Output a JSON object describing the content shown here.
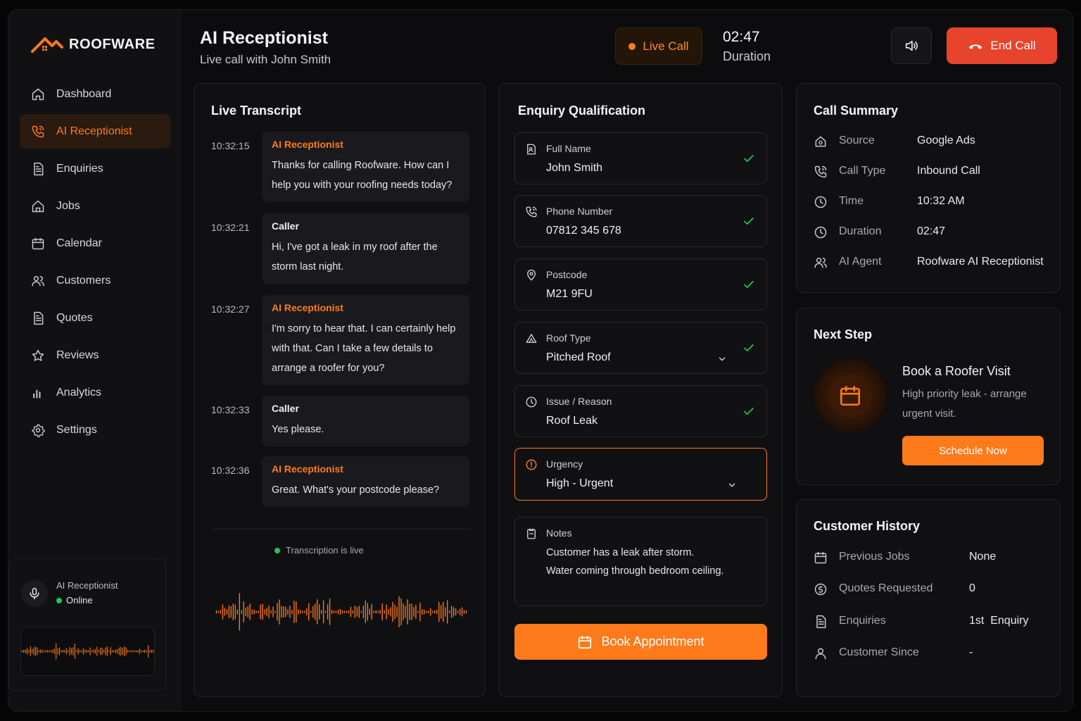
{
  "brand": {
    "name": "ROOFWARE"
  },
  "sidebar": {
    "items": [
      {
        "label": "Dashboard",
        "icon": "home-icon"
      },
      {
        "label": "AI Receptionist",
        "icon": "phone-icon",
        "active": true
      },
      {
        "label": "Enquiries",
        "icon": "document-icon"
      },
      {
        "label": "Jobs",
        "icon": "house-icon"
      },
      {
        "label": "Calendar",
        "icon": "calendar-icon"
      },
      {
        "label": "Customers",
        "icon": "users-icon"
      },
      {
        "label": "Quotes",
        "icon": "document-icon"
      },
      {
        "label": "Reviews",
        "icon": "star-icon"
      },
      {
        "label": "Analytics",
        "icon": "bar-chart-icon"
      },
      {
        "label": "Settings",
        "icon": "gear-icon"
      }
    ],
    "agent": {
      "name": "AI Receptionist",
      "status": "Online"
    }
  },
  "header": {
    "title": "AI Receptionist",
    "subtitle": "Live call with John Smith",
    "live_label": "Live Call",
    "timer": "02:47",
    "timer_label": "Duration",
    "end_call_label": "End Call"
  },
  "transcript": {
    "title": "Live Transcript",
    "messages": [
      {
        "time": "10:32:15",
        "speaker": "AI Receptionist",
        "text": "Thanks for calling Roofware. How can I help you with your roofing needs today?"
      },
      {
        "time": "10:32:21",
        "speaker": "Caller",
        "text": "Hi, I've got a leak in my roof after the storm last night."
      },
      {
        "time": "10:32:27",
        "speaker": "AI Receptionist",
        "text": "I'm sorry to hear that. I can certainly help with that. Can I take a few details to arrange a roofer for you?"
      },
      {
        "time": "10:32:33",
        "speaker": "Caller",
        "text": "Yes please."
      },
      {
        "time": "10:32:36",
        "speaker": "AI Receptionist",
        "text": "Great. What's your postcode please?"
      }
    ],
    "live_status": "Transcription is live"
  },
  "enquiry": {
    "title": "Enquiry Qualification",
    "fields": [
      {
        "label": "Full Name",
        "value": "John Smith",
        "icon": "id-card-icon",
        "verified": true
      },
      {
        "label": "Phone Number",
        "value": "07812 345 678",
        "icon": "phone-icon",
        "verified": true
      },
      {
        "label": "Postcode",
        "value": "M21 9FU",
        "icon": "map-pin-icon",
        "verified": true
      },
      {
        "label": "Roof Type",
        "value": "Pitched Roof",
        "icon": "roof-icon",
        "verified": true,
        "dropdown": true
      },
      {
        "label": "Issue / Reason",
        "value": "Roof Leak",
        "icon": "issue-icon",
        "verified": true
      },
      {
        "label": "Urgency",
        "value": "High - Urgent",
        "icon": "alert-icon",
        "dropdown": true,
        "highlight": true
      }
    ],
    "notes": {
      "label": "Notes",
      "line1": "Customer has a leak after storm.",
      "line2": "Water coming through bedroom ceiling."
    },
    "book_label": "Book Appointment"
  },
  "summary": {
    "title": "Call Summary",
    "rows": [
      {
        "label": "Source",
        "value": "Google Ads",
        "icon": "source-icon"
      },
      {
        "label": "Call Type",
        "value": "Inbound Call",
        "icon": "phone-icon"
      },
      {
        "label": "Time",
        "value": "10:32 AM",
        "icon": "clock-icon"
      },
      {
        "label": "Duration",
        "value": "02:47",
        "icon": "clock-icon"
      },
      {
        "label": "AI Agent",
        "value": "Roofware AI Receptionist",
        "icon": "users-icon"
      }
    ]
  },
  "next_step": {
    "title": "Next Step",
    "action": "Book a Roofer Visit",
    "description": "High priority leak - arrange urgent visit.",
    "button": "Schedule Now"
  },
  "history": {
    "title": "Customer History",
    "rows": [
      {
        "label": "Previous Jobs",
        "value": "None",
        "icon": "calendar-icon"
      },
      {
        "label": "Quotes Requested",
        "value": "0",
        "icon": "coin-icon"
      },
      {
        "label": "Enquiries",
        "value": "1st  Enquiry",
        "icon": "document-icon"
      },
      {
        "label": "Customer Since",
        "value": "-",
        "icon": "user-icon"
      }
    ]
  },
  "colors": {
    "accent": "#ff7a1a",
    "danger": "#e8432c",
    "success": "#22c55e",
    "background": "#0c0c0e"
  }
}
